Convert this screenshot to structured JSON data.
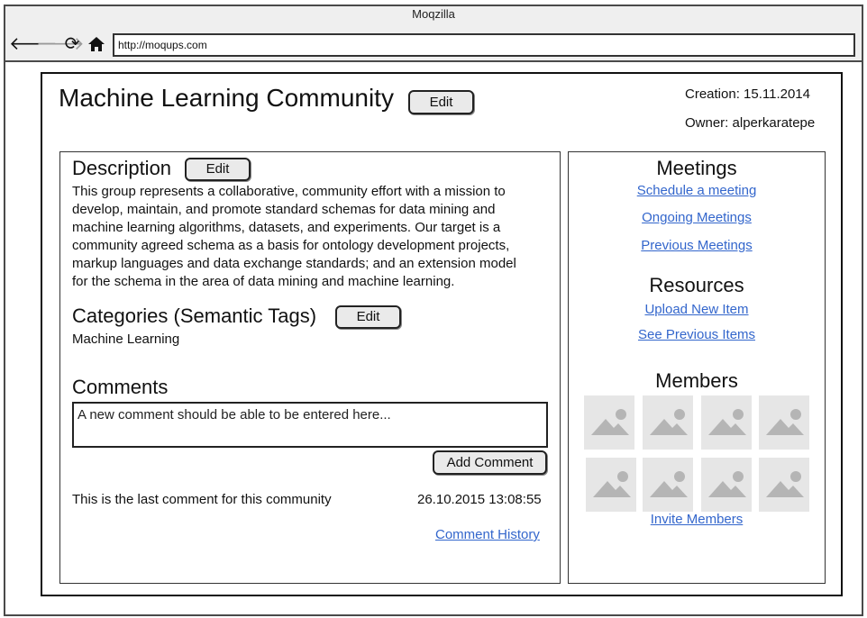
{
  "browser": {
    "window_title": "Moqzilla",
    "url": "http://moqups.com",
    "nav_icons": [
      "back-arrow-icon",
      "forward-arrow-icon",
      "reload-icon",
      "home-icon"
    ]
  },
  "header": {
    "title": "Machine Learning Community",
    "edit_label": "Edit",
    "creation": "Creation: 15.11.2014",
    "owner": "Owner: alperkaratepe"
  },
  "description": {
    "heading": "Description",
    "edit_label": "Edit",
    "lines": [
      "This group represents a collaborative, community effort with a mission to",
      "develop, maintain, and promote standard schemas for data mining and",
      "machine learning algorithms, datasets, and experiments. Our target is a",
      "community agreed schema as a basis for ontology development projects,",
      "markup languages and data exchange standards; and an extension model",
      "for the schema in the area of data mining and machine learning."
    ]
  },
  "categories": {
    "heading": "Categories (Semantic Tags)",
    "edit_label": "Edit",
    "value": "Machine Learning"
  },
  "comments": {
    "heading": "Comments",
    "input_value": "A new comment should be able to be entered here...",
    "add_label": "Add Comment",
    "last_comment": "This is the last comment for this community",
    "last_comment_time": "26.10.2015 13:08:55",
    "history_link": "Comment History"
  },
  "sidebar": {
    "meetings": {
      "heading": "Meetings",
      "links": [
        "Schedule a meeting",
        "Ongoing Meetings",
        "Previous Meetings"
      ]
    },
    "resources": {
      "heading": "Resources",
      "links": [
        "Upload New Item",
        "See Previous Items"
      ]
    },
    "members": {
      "heading": "Members",
      "avatar_icon": "image-placeholder-icon",
      "avatar_count": 8,
      "invite_link": "Invite Members"
    }
  }
}
